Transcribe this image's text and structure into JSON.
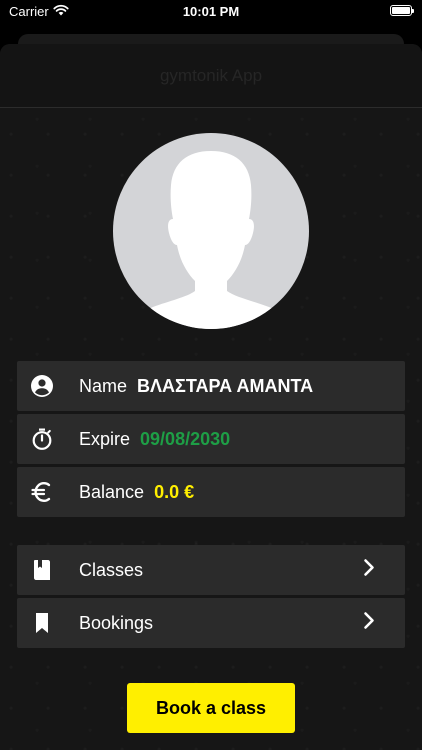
{
  "status_bar": {
    "carrier": "Carrier",
    "time": "10:01 PM",
    "icons": [
      "wifi-icon",
      "battery-icon"
    ]
  },
  "nav": {
    "title": "gymtonik App"
  },
  "profile": {
    "avatar_icon": "person-silhouette-icon"
  },
  "info": {
    "name_label": "Name",
    "name_value": "ΒΛΑΣΤΑΡΑ ΑΜΑΝΤΑ",
    "expire_label": "Expire",
    "expire_value": "09/08/2030",
    "expire_color": "#1e9e46",
    "balance_label": "Balance",
    "balance_value": "0.0 €",
    "balance_color": "#ffef00"
  },
  "menu": {
    "classes_label": "Classes",
    "bookings_label": "Bookings"
  },
  "actions": {
    "book_label": "Book a class",
    "accent": "#ffef00"
  }
}
